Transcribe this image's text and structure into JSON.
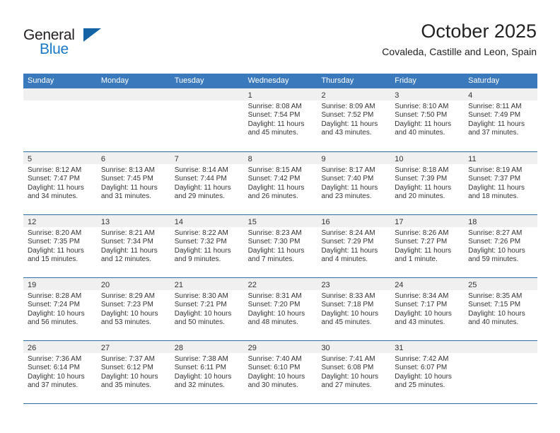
{
  "brand": {
    "name_part1": "General",
    "name_part2": "Blue",
    "accent_color": "#1b79c6",
    "triangle_color": "#1464a5",
    "triangle_icon": "triangle-icon"
  },
  "header": {
    "month_title": "October 2025",
    "location": "Covaleda, Castille and Leon, Spain"
  },
  "calendar": {
    "header_color": "#3b79bd",
    "row_divider_color": "#2e6da4",
    "day_band_color": "#f0f0f0",
    "weekdays": [
      "Sunday",
      "Monday",
      "Tuesday",
      "Wednesday",
      "Thursday",
      "Friday",
      "Saturday"
    ],
    "weeks": [
      [
        {
          "day": "",
          "empty": true,
          "lines": []
        },
        {
          "day": "",
          "empty": true,
          "lines": []
        },
        {
          "day": "",
          "empty": true,
          "lines": []
        },
        {
          "day": "1",
          "empty": false,
          "lines": [
            "Sunrise: 8:08 AM",
            "Sunset: 7:54 PM",
            "Daylight: 11 hours",
            "and 45 minutes."
          ]
        },
        {
          "day": "2",
          "empty": false,
          "lines": [
            "Sunrise: 8:09 AM",
            "Sunset: 7:52 PM",
            "Daylight: 11 hours",
            "and 43 minutes."
          ]
        },
        {
          "day": "3",
          "empty": false,
          "lines": [
            "Sunrise: 8:10 AM",
            "Sunset: 7:50 PM",
            "Daylight: 11 hours",
            "and 40 minutes."
          ]
        },
        {
          "day": "4",
          "empty": false,
          "lines": [
            "Sunrise: 8:11 AM",
            "Sunset: 7:49 PM",
            "Daylight: 11 hours",
            "and 37 minutes."
          ]
        }
      ],
      [
        {
          "day": "5",
          "empty": false,
          "lines": [
            "Sunrise: 8:12 AM",
            "Sunset: 7:47 PM",
            "Daylight: 11 hours",
            "and 34 minutes."
          ]
        },
        {
          "day": "6",
          "empty": false,
          "lines": [
            "Sunrise: 8:13 AM",
            "Sunset: 7:45 PM",
            "Daylight: 11 hours",
            "and 31 minutes."
          ]
        },
        {
          "day": "7",
          "empty": false,
          "lines": [
            "Sunrise: 8:14 AM",
            "Sunset: 7:44 PM",
            "Daylight: 11 hours",
            "and 29 minutes."
          ]
        },
        {
          "day": "8",
          "empty": false,
          "lines": [
            "Sunrise: 8:15 AM",
            "Sunset: 7:42 PM",
            "Daylight: 11 hours",
            "and 26 minutes."
          ]
        },
        {
          "day": "9",
          "empty": false,
          "lines": [
            "Sunrise: 8:17 AM",
            "Sunset: 7:40 PM",
            "Daylight: 11 hours",
            "and 23 minutes."
          ]
        },
        {
          "day": "10",
          "empty": false,
          "lines": [
            "Sunrise: 8:18 AM",
            "Sunset: 7:39 PM",
            "Daylight: 11 hours",
            "and 20 minutes."
          ]
        },
        {
          "day": "11",
          "empty": false,
          "lines": [
            "Sunrise: 8:19 AM",
            "Sunset: 7:37 PM",
            "Daylight: 11 hours",
            "and 18 minutes."
          ]
        }
      ],
      [
        {
          "day": "12",
          "empty": false,
          "lines": [
            "Sunrise: 8:20 AM",
            "Sunset: 7:35 PM",
            "Daylight: 11 hours",
            "and 15 minutes."
          ]
        },
        {
          "day": "13",
          "empty": false,
          "lines": [
            "Sunrise: 8:21 AM",
            "Sunset: 7:34 PM",
            "Daylight: 11 hours",
            "and 12 minutes."
          ]
        },
        {
          "day": "14",
          "empty": false,
          "lines": [
            "Sunrise: 8:22 AM",
            "Sunset: 7:32 PM",
            "Daylight: 11 hours",
            "and 9 minutes."
          ]
        },
        {
          "day": "15",
          "empty": false,
          "lines": [
            "Sunrise: 8:23 AM",
            "Sunset: 7:30 PM",
            "Daylight: 11 hours",
            "and 7 minutes."
          ]
        },
        {
          "day": "16",
          "empty": false,
          "lines": [
            "Sunrise: 8:24 AM",
            "Sunset: 7:29 PM",
            "Daylight: 11 hours",
            "and 4 minutes."
          ]
        },
        {
          "day": "17",
          "empty": false,
          "lines": [
            "Sunrise: 8:26 AM",
            "Sunset: 7:27 PM",
            "Daylight: 11 hours",
            "and 1 minute."
          ]
        },
        {
          "day": "18",
          "empty": false,
          "lines": [
            "Sunrise: 8:27 AM",
            "Sunset: 7:26 PM",
            "Daylight: 10 hours",
            "and 59 minutes."
          ]
        }
      ],
      [
        {
          "day": "19",
          "empty": false,
          "lines": [
            "Sunrise: 8:28 AM",
            "Sunset: 7:24 PM",
            "Daylight: 10 hours",
            "and 56 minutes."
          ]
        },
        {
          "day": "20",
          "empty": false,
          "lines": [
            "Sunrise: 8:29 AM",
            "Sunset: 7:23 PM",
            "Daylight: 10 hours",
            "and 53 minutes."
          ]
        },
        {
          "day": "21",
          "empty": false,
          "lines": [
            "Sunrise: 8:30 AM",
            "Sunset: 7:21 PM",
            "Daylight: 10 hours",
            "and 50 minutes."
          ]
        },
        {
          "day": "22",
          "empty": false,
          "lines": [
            "Sunrise: 8:31 AM",
            "Sunset: 7:20 PM",
            "Daylight: 10 hours",
            "and 48 minutes."
          ]
        },
        {
          "day": "23",
          "empty": false,
          "lines": [
            "Sunrise: 8:33 AM",
            "Sunset: 7:18 PM",
            "Daylight: 10 hours",
            "and 45 minutes."
          ]
        },
        {
          "day": "24",
          "empty": false,
          "lines": [
            "Sunrise: 8:34 AM",
            "Sunset: 7:17 PM",
            "Daylight: 10 hours",
            "and 43 minutes."
          ]
        },
        {
          "day": "25",
          "empty": false,
          "lines": [
            "Sunrise: 8:35 AM",
            "Sunset: 7:15 PM",
            "Daylight: 10 hours",
            "and 40 minutes."
          ]
        }
      ],
      [
        {
          "day": "26",
          "empty": false,
          "lines": [
            "Sunrise: 7:36 AM",
            "Sunset: 6:14 PM",
            "Daylight: 10 hours",
            "and 37 minutes."
          ]
        },
        {
          "day": "27",
          "empty": false,
          "lines": [
            "Sunrise: 7:37 AM",
            "Sunset: 6:12 PM",
            "Daylight: 10 hours",
            "and 35 minutes."
          ]
        },
        {
          "day": "28",
          "empty": false,
          "lines": [
            "Sunrise: 7:38 AM",
            "Sunset: 6:11 PM",
            "Daylight: 10 hours",
            "and 32 minutes."
          ]
        },
        {
          "day": "29",
          "empty": false,
          "lines": [
            "Sunrise: 7:40 AM",
            "Sunset: 6:10 PM",
            "Daylight: 10 hours",
            "and 30 minutes."
          ]
        },
        {
          "day": "30",
          "empty": false,
          "lines": [
            "Sunrise: 7:41 AM",
            "Sunset: 6:08 PM",
            "Daylight: 10 hours",
            "and 27 minutes."
          ]
        },
        {
          "day": "31",
          "empty": false,
          "lines": [
            "Sunrise: 7:42 AM",
            "Sunset: 6:07 PM",
            "Daylight: 10 hours",
            "and 25 minutes."
          ]
        },
        {
          "day": "",
          "empty": true,
          "lines": []
        }
      ]
    ]
  }
}
